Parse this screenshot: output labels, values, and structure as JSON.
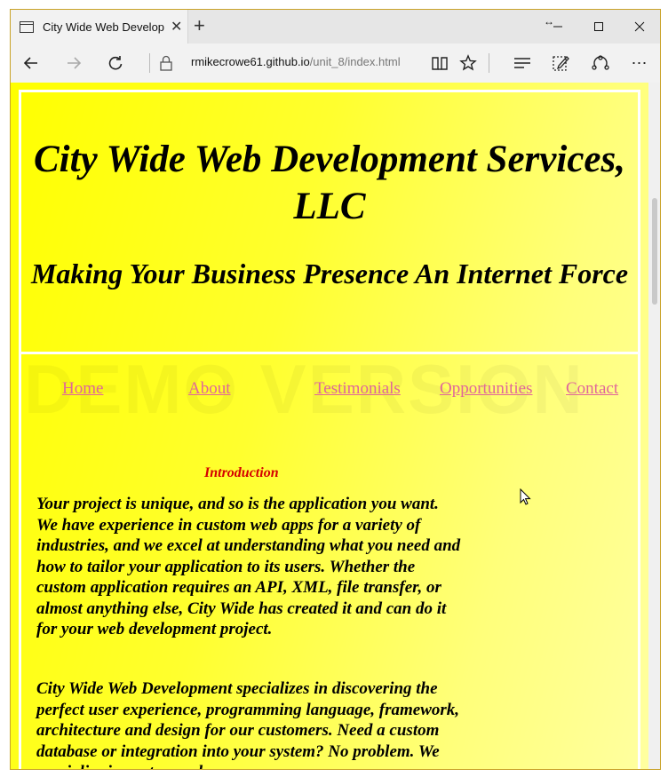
{
  "browser": {
    "tab_title": "City Wide Web Develop",
    "tab_close": "✕",
    "new_tab": "+",
    "url_host": "rmikecrowe61.github.io",
    "url_path": "/unit_8/index.html"
  },
  "page": {
    "title": "City Wide Web Development Services, LLC",
    "tagline": "Making Your Business Presence An Internet Force",
    "watermark": "DEMO VERSION",
    "nav": [
      "Home",
      "About",
      "Testimonials",
      "Opportunities",
      "Contact"
    ],
    "section_heading": "Introduction",
    "paragraphs": [
      "Your project is unique, and so is the application you want. We have experience in custom web apps for a variety of industries, and we excel at understanding what you need and how to tailor your application to its users. Whether the custom application requires an API, XML, file transfer, or almost anything else, City Wide has created it and can do it for your web development project.",
      "City Wide Web Development specializes in discovering the perfect user experience, programming language, framework, architecture and design for our customers. Need a custom database or integration into your system? No problem. We specialize in custom web"
    ]
  },
  "colors": {
    "page_background": "#ffff00",
    "link": "#e0669a",
    "section_heading": "#d40000"
  }
}
